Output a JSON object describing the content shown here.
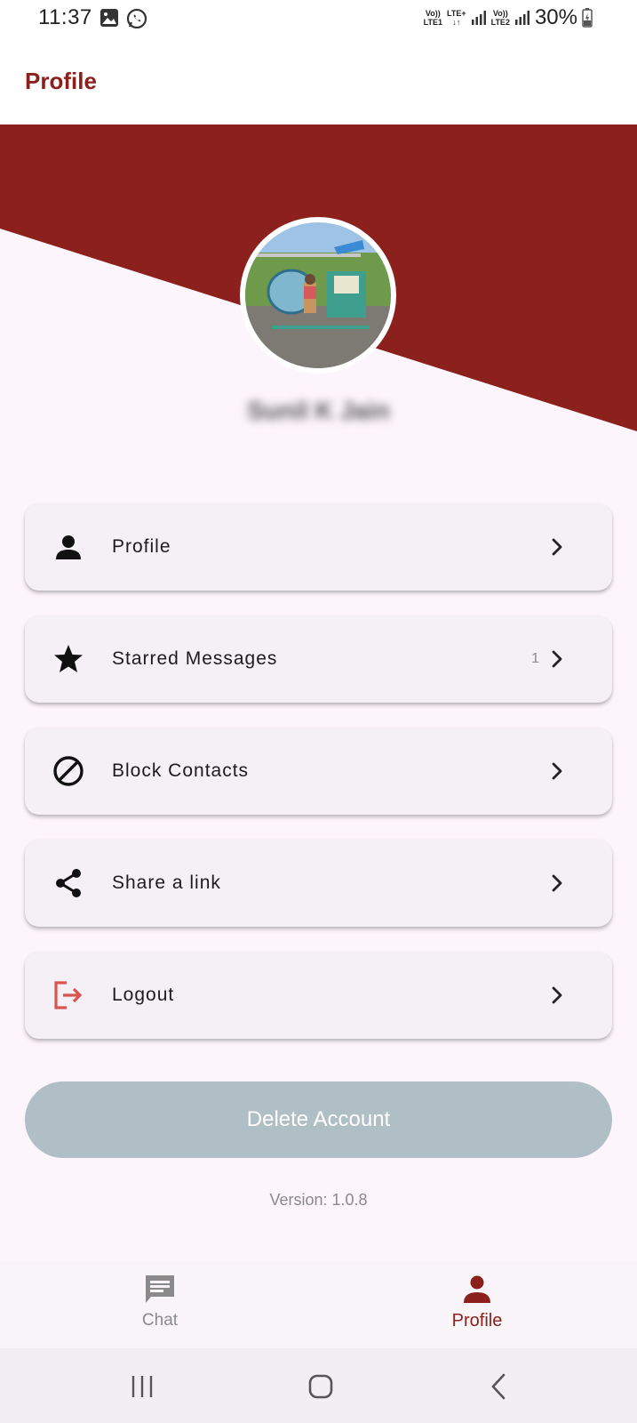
{
  "status_bar": {
    "time": "11:37",
    "sim1_label": [
      "Vo))",
      "LTE1"
    ],
    "lte_plus_label": [
      "LTE+",
      "↓↑"
    ],
    "sim2_label": [
      "Vo))",
      "LTE2"
    ],
    "battery": "30%"
  },
  "app_bar": {
    "title": "Profile"
  },
  "profile": {
    "name": "Sunil K Jain"
  },
  "menu": {
    "items": [
      {
        "label": "Profile",
        "icon": "person-icon"
      },
      {
        "label": "Starred Messages",
        "icon": "star-icon",
        "count": "1"
      },
      {
        "label": "Block Contacts",
        "icon": "block-icon"
      },
      {
        "label": "Share a link",
        "icon": "share-icon"
      },
      {
        "label": "Logout",
        "icon": "logout-icon"
      }
    ]
  },
  "delete_button": {
    "label": "Delete Account"
  },
  "version": "Version: 1.0.8",
  "bottom_nav": {
    "items": [
      {
        "label": "Chat",
        "icon": "chat-icon",
        "active": false
      },
      {
        "label": "Profile",
        "icon": "person-icon",
        "active": true
      }
    ]
  },
  "colors": {
    "brand": "#8b201c",
    "background": "#fcf5fb",
    "card": "#f5f0f6",
    "delete_button": "#b0bec5",
    "logout_icon": "#d9534f"
  }
}
